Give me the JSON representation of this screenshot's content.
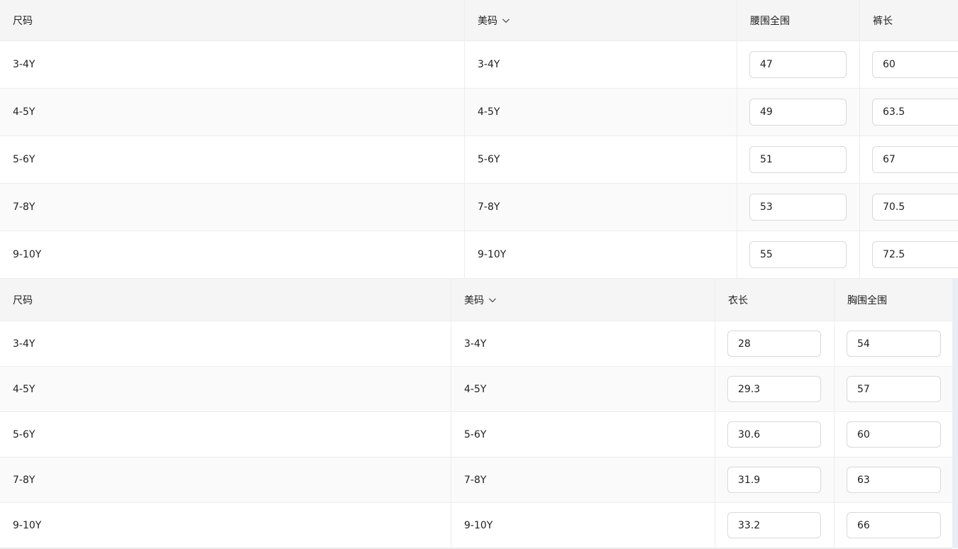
{
  "tables": [
    {
      "headers": {
        "size": "尺码",
        "us_size": "美码",
        "measure_a": "腰围全围",
        "measure_b": "裤长"
      },
      "rows": [
        {
          "size": "3-4Y",
          "us_size": "3-4Y",
          "a": "47",
          "b": "60"
        },
        {
          "size": "4-5Y",
          "us_size": "4-5Y",
          "a": "49",
          "b": "63.5"
        },
        {
          "size": "5-6Y",
          "us_size": "5-6Y",
          "a": "51",
          "b": "67"
        },
        {
          "size": "7-8Y",
          "us_size": "7-8Y",
          "a": "53",
          "b": "70.5"
        },
        {
          "size": "9-10Y",
          "us_size": "9-10Y",
          "a": "55",
          "b": "72.5"
        }
      ]
    },
    {
      "headers": {
        "size": "尺码",
        "us_size": "美码",
        "measure_a": "衣长",
        "measure_b": "胸围全围"
      },
      "rows": [
        {
          "size": "3-4Y",
          "us_size": "3-4Y",
          "a": "28",
          "b": "54"
        },
        {
          "size": "4-5Y",
          "us_size": "4-5Y",
          "a": "29.3",
          "b": "57"
        },
        {
          "size": "5-6Y",
          "us_size": "5-6Y",
          "a": "30.6",
          "b": "60"
        },
        {
          "size": "7-8Y",
          "us_size": "7-8Y",
          "a": "31.9",
          "b": "63"
        },
        {
          "size": "9-10Y",
          "us_size": "9-10Y",
          "a": "33.2",
          "b": "66"
        }
      ]
    }
  ],
  "icons": {
    "sort": "chevron-down-icon"
  }
}
